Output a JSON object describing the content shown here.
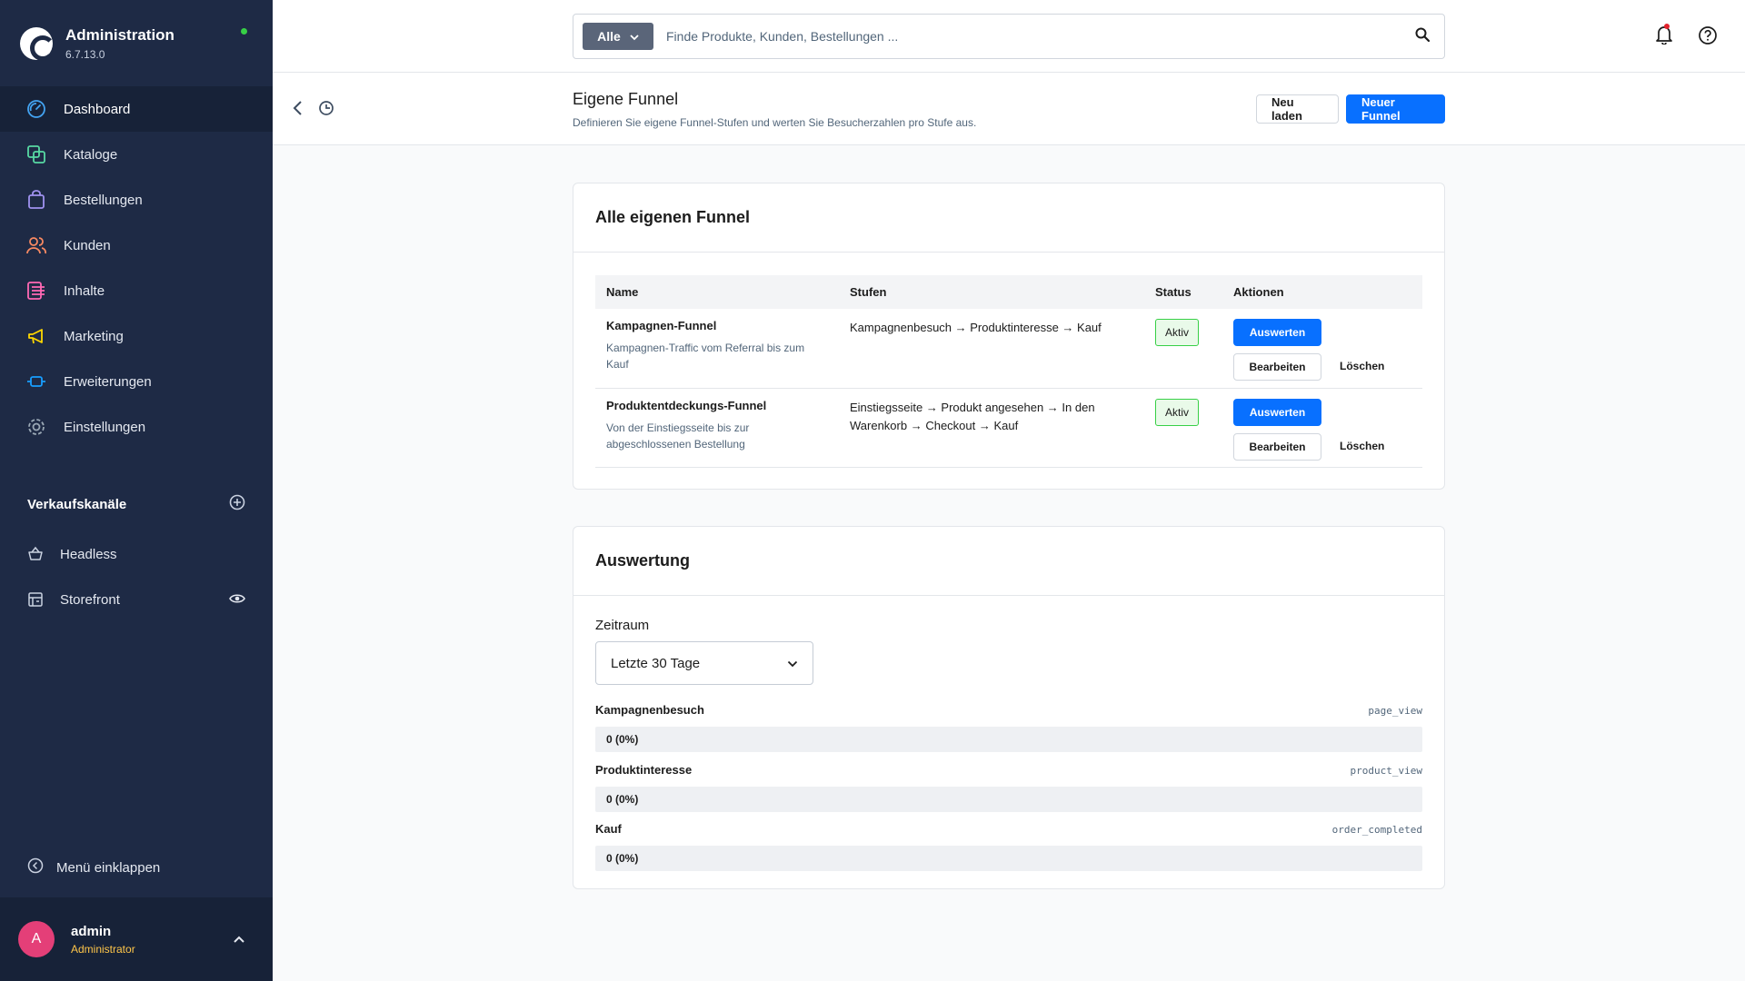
{
  "app": {
    "title": "Administration",
    "version": "6.7.13.0"
  },
  "sidebar": {
    "items": [
      {
        "label": "Dashboard",
        "icon": "dashboard-icon",
        "color": "#43a3f1",
        "active": true
      },
      {
        "label": "Kataloge",
        "icon": "catalogue-icon",
        "color": "#57d9a3"
      },
      {
        "label": "Bestellungen",
        "icon": "bag-icon",
        "color": "#a092f0"
      },
      {
        "label": "Kunden",
        "icon": "customers-icon",
        "color": "#f88962"
      },
      {
        "label": "Inhalte",
        "icon": "content-icon",
        "color": "#ff68b4"
      },
      {
        "label": "Marketing",
        "icon": "megaphone-icon",
        "color": "#ffd700"
      },
      {
        "label": "Erweiterungen",
        "icon": "extensions-icon",
        "color": "#189eff"
      },
      {
        "label": "Einstellungen",
        "icon": "gear-icon",
        "color": "#9aa8b5"
      }
    ],
    "sales_channels_title": "Verkaufskanäle",
    "channels": [
      {
        "label": "Headless",
        "icon": "basket-icon"
      },
      {
        "label": "Storefront",
        "icon": "storefront-icon"
      }
    ],
    "collapse_label": "Menü einklappen"
  },
  "user": {
    "initial": "A",
    "name": "admin",
    "role": "Administrator"
  },
  "search": {
    "type_label": "Alle",
    "placeholder": "Finde Produkte, Kunden, Bestellungen ..."
  },
  "page": {
    "title": "Eigene Funnel",
    "subtitle": "Definieren Sie eigene Funnel-Stufen und werten Sie Besucherzahlen pro Stufe aus.",
    "reload_label": "Neu laden",
    "new_label": "Neuer Funnel"
  },
  "funnels_card": {
    "title": "Alle eigenen Funnel",
    "columns": [
      "Name",
      "Stufen",
      "Status",
      "Aktionen"
    ],
    "rows": [
      {
        "name": "Kampagnen-Funnel",
        "description": "Kampagnen-Traffic vom Referral bis zum Kauf",
        "steps": "Kampagnenbesuch → Produktinteresse → Kauf",
        "status": "Aktiv",
        "evaluate": "Auswerten",
        "edit": "Bearbeiten",
        "delete": "Löschen"
      },
      {
        "name": "Produktentdeckungs-Funnel",
        "description": "Von der Einstiegsseite bis zur abgeschlossenen Bestellung",
        "steps": "Einstiegsseite → Produkt angesehen → In den Warenkorb → Checkout → Kauf",
        "status": "Aktiv",
        "evaluate": "Auswerten",
        "edit": "Bearbeiten",
        "delete": "Löschen"
      }
    ]
  },
  "evaluation_card": {
    "title": "Auswertung",
    "period_label": "Zeitraum",
    "period_value": "Letzte 30 Tage",
    "stages": [
      {
        "name": "Kampagnenbesuch",
        "event": "page_view",
        "value": "0 (0%)",
        "fraction": 0
      },
      {
        "name": "Produktinteresse",
        "event": "product_view",
        "value": "0 (0%)",
        "fraction": 0
      },
      {
        "name": "Kauf",
        "event": "order_completed",
        "value": "0 (0%)",
        "fraction": 0
      }
    ]
  },
  "colors": {
    "primary": "#0870ff",
    "sidebar": "#1e2a45",
    "active_badge_border": "#37d046",
    "avatar": "#e43f78",
    "role": "#ffc64a"
  }
}
